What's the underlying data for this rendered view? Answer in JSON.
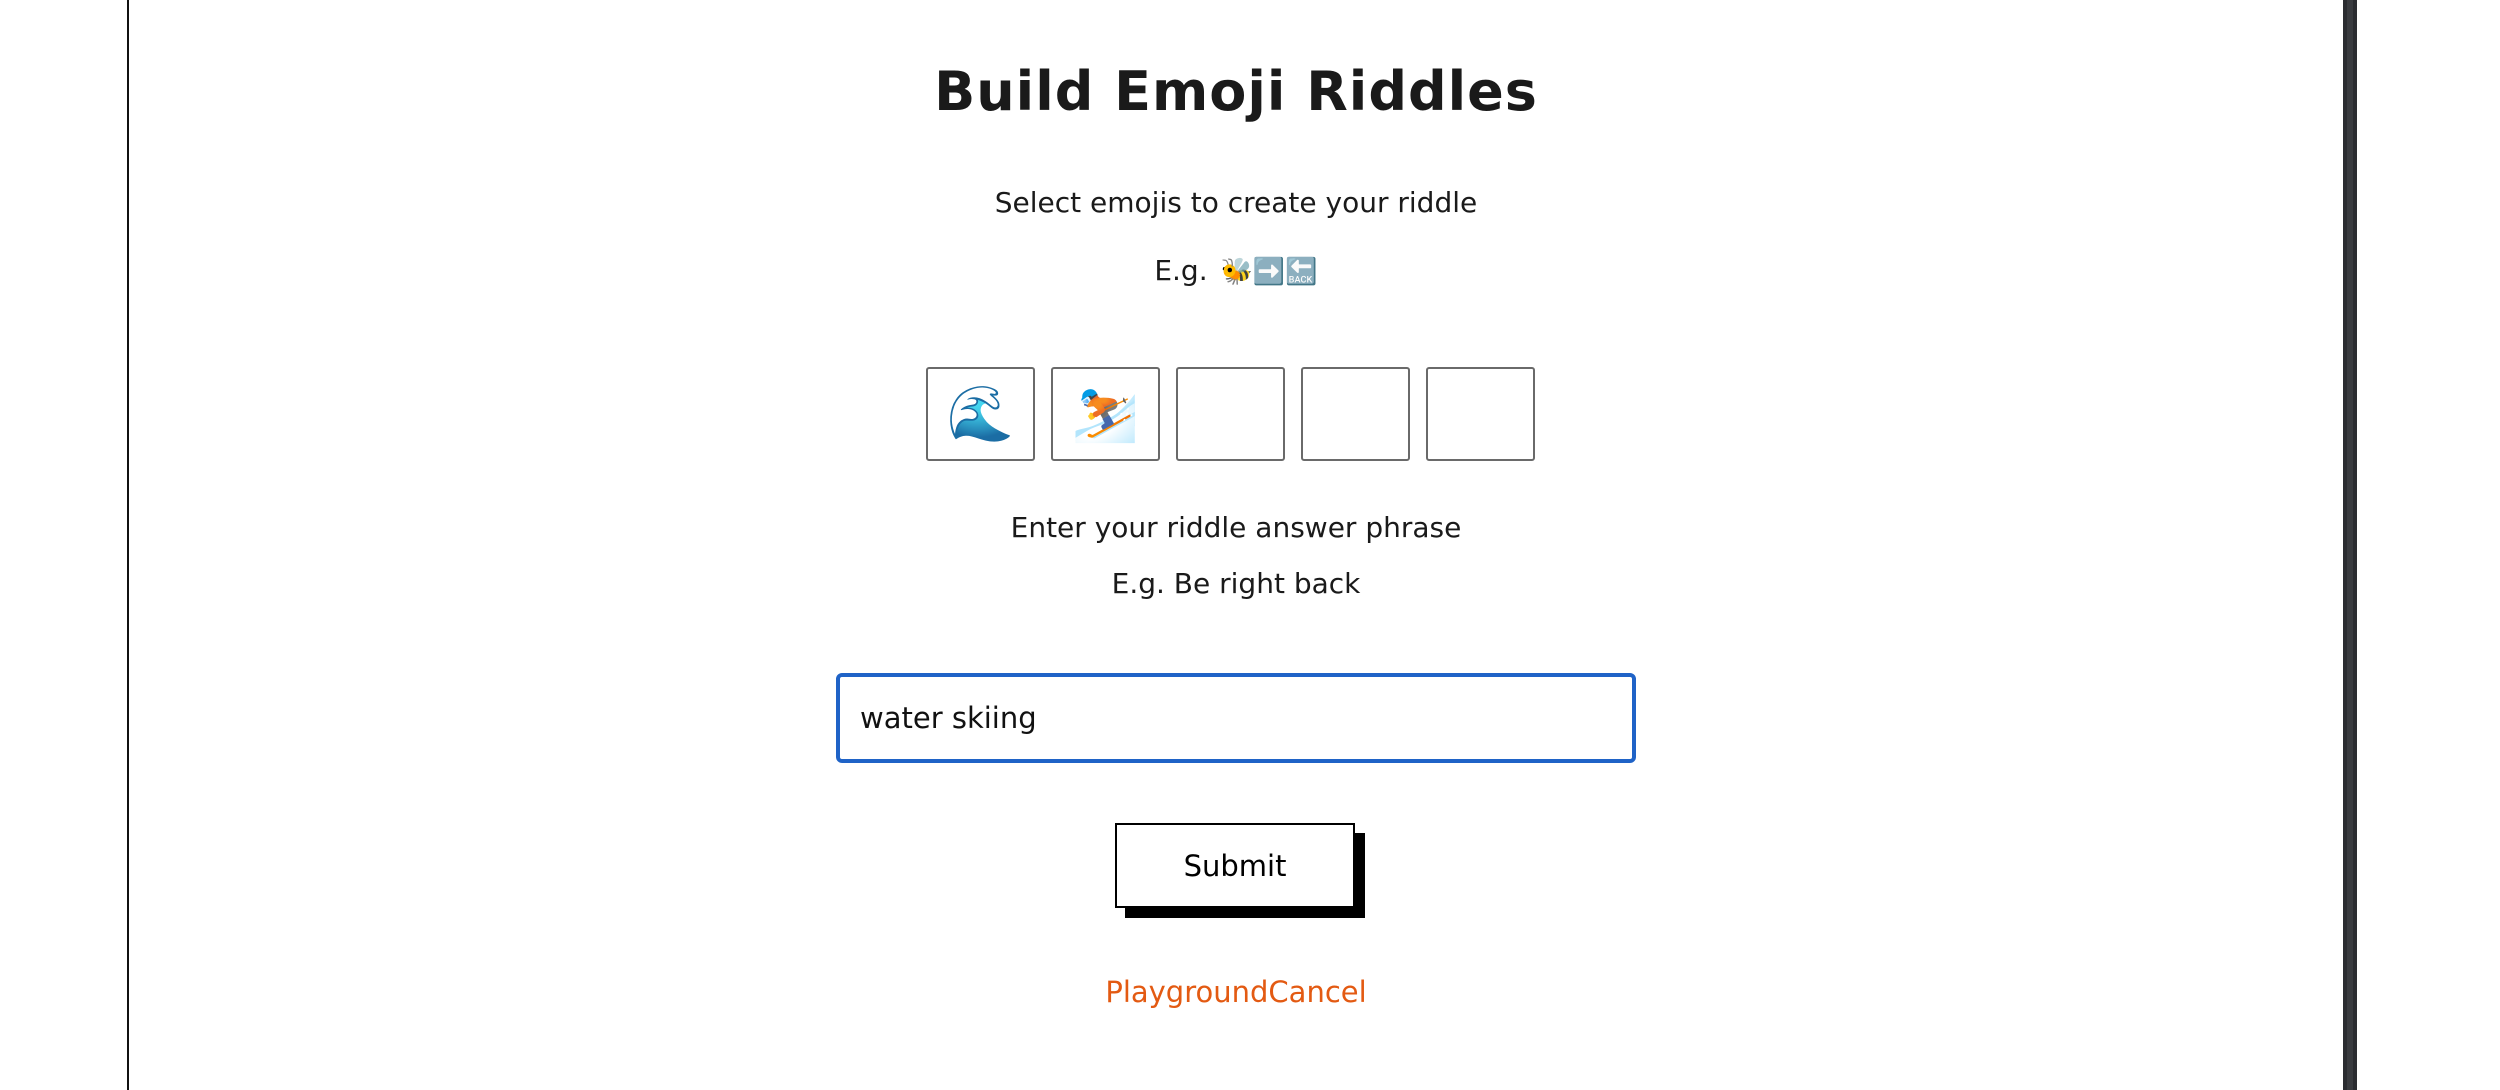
{
  "page": {
    "title": "Build Emoji Riddles",
    "select_instruction": "Select emojis to create your riddle",
    "emoji_example_prefix": "E.g.",
    "emoji_example_emojis": "🐝➡️🔙"
  },
  "emoji_slots": [
    "🌊",
    "⛷️",
    "",
    "",
    ""
  ],
  "answer": {
    "label": "Enter your riddle answer phrase",
    "example": "E.g. Be right back",
    "value": "water skiing"
  },
  "actions": {
    "submit_label": "Submit",
    "playground_link": "Playground",
    "cancel_link": "Cancel"
  },
  "colors": {
    "input_focus_border": "#1f63c7",
    "link": "#e35a12"
  }
}
